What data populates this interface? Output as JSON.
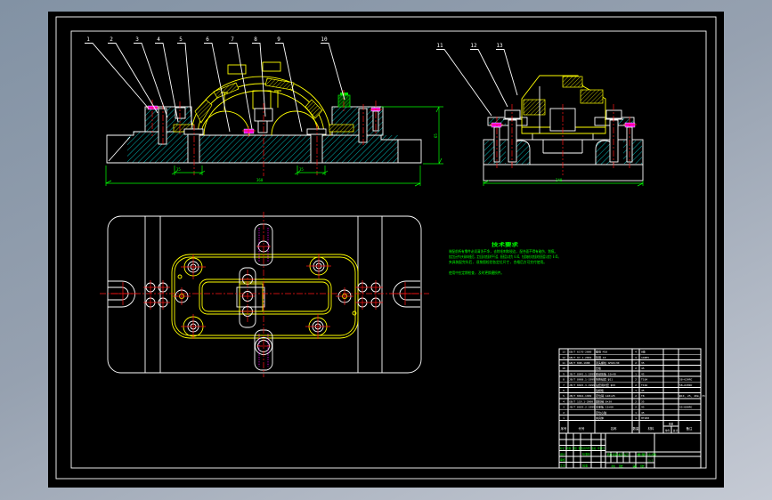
{
  "window": {
    "canvas_bg": "#000000",
    "frame_color": "#ffffff",
    "bg_gradient_start": "#8292a4",
    "bg_gradient_end": "#c5cad4"
  },
  "colors": {
    "part_outline": "#ffff00",
    "section_hatch": "#00ffff",
    "centerline": "#ff1515",
    "dimension": "#00ff00",
    "detail": "#ff00ff",
    "edge": "#ffffff",
    "special_part": "#00dd00"
  },
  "balloons": {
    "front": [
      "1",
      "2",
      "3",
      "4",
      "5",
      "6",
      "7",
      "8",
      "9",
      "10"
    ],
    "side": [
      "11",
      "12",
      "13"
    ]
  },
  "dimensions": {
    "front_overall": "360",
    "front_left_stud": "35",
    "front_right_stud": "35",
    "front_height": "65",
    "side_overall": "240"
  },
  "tech_requirements": {
    "title": "技术要求",
    "lines": [
      "装配前所有零件必须清洗干净, 去除毛刺和锐边, 配合面不得有碰伤、划痕。",
      "各定位元件与夹具体装配后, 定位面对底面的平行度、垂直度公差为 0.02, 钻套轴线对底面的垂直度公差为 0.05。",
      "夹具装配完毕后, 须按图检验各定位尺寸, 合格后方可交付使用。",
      "使用中应定期检查, 及时更换磨损件。"
    ]
  },
  "bom": {
    "headers": {
      "num": "序号",
      "code": "代号",
      "name": "名称",
      "qty": "数量",
      "material": "材料",
      "weight": "重量",
      "weight_each": "单件",
      "weight_total": "总计",
      "remark": "备注"
    },
    "rows": [
      {
        "num": "13",
        "code": "GB/T 6170-2000",
        "name": "螺母 M10",
        "qty": "4",
        "mtl": "8级",
        "rem": ""
      },
      {
        "num": "12",
        "code": "GB/T 97.1-2002",
        "name": "垫圈 10",
        "qty": "4",
        "mtl": "140HV",
        "rem": ""
      },
      {
        "num": "11",
        "code": "GB/T 898-1988",
        "name": "双头螺柱 AM10×30",
        "qty": "2",
        "mtl": "35",
        "rem": ""
      },
      {
        "num": "10",
        "code": "",
        "name": "压板",
        "qty": "2",
        "mtl": "45",
        "rem": ""
      },
      {
        "num": "9",
        "code": "JB/T 8045.1-1999",
        "name": "移动压板 10×40",
        "qty": "1",
        "mtl": "45",
        "rem": ""
      },
      {
        "num": "8",
        "code": "JB/T 8008.1-1999",
        "name": "快换钻套 φ11",
        "qty": "2",
        "mtl": "T10A",
        "rem": "58~62HRC"
      },
      {
        "num": "7",
        "code": "JB/T 8045.3-1999",
        "name": "钻套用衬套 φ15",
        "qty": "2",
        "mtl": "T10A",
        "rem": "58~62HRC"
      },
      {
        "num": "6",
        "code": "",
        "name": "钻模板",
        "qty": "1",
        "mtl": "45",
        "rem": ""
      },
      {
        "num": "5",
        "code": "JB/T 8044-1999",
        "name": "定位销 A10×25",
        "qty": "2",
        "mtl": "T8",
        "rem": "φ10, 25, 40m, 35"
      },
      {
        "num": "4",
        "code": "GB/T 119.1-2000",
        "name": "圆柱销 8×30",
        "qty": "2",
        "mtl": "35",
        "rem": ""
      },
      {
        "num": "3",
        "code": "JB/T 8029.2-1999",
        "name": "支承板 12×60",
        "qty": "2",
        "mtl": "45",
        "rem": "55~60HRC"
      },
      {
        "num": "2",
        "code": "",
        "name": "定位心轴",
        "qty": "1",
        "mtl": "45",
        "rem": ""
      },
      {
        "num": "1",
        "code": "",
        "name": "夹具体",
        "qty": "1",
        "mtl": "HT200",
        "rem": ""
      }
    ]
  },
  "title_block": {
    "revision_header": "标记 处数 分区 更改文件号 签名 年月日",
    "design": "设计",
    "audit": "审核",
    "process": "工艺",
    "standardize": "标准化",
    "approve": "批准",
    "stage_label": "阶段标记",
    "weight_label": "重量",
    "scale_label": "比例",
    "scale_value": "1:1",
    "sheet_total": "共 张",
    "sheet_index": "第 张"
  }
}
